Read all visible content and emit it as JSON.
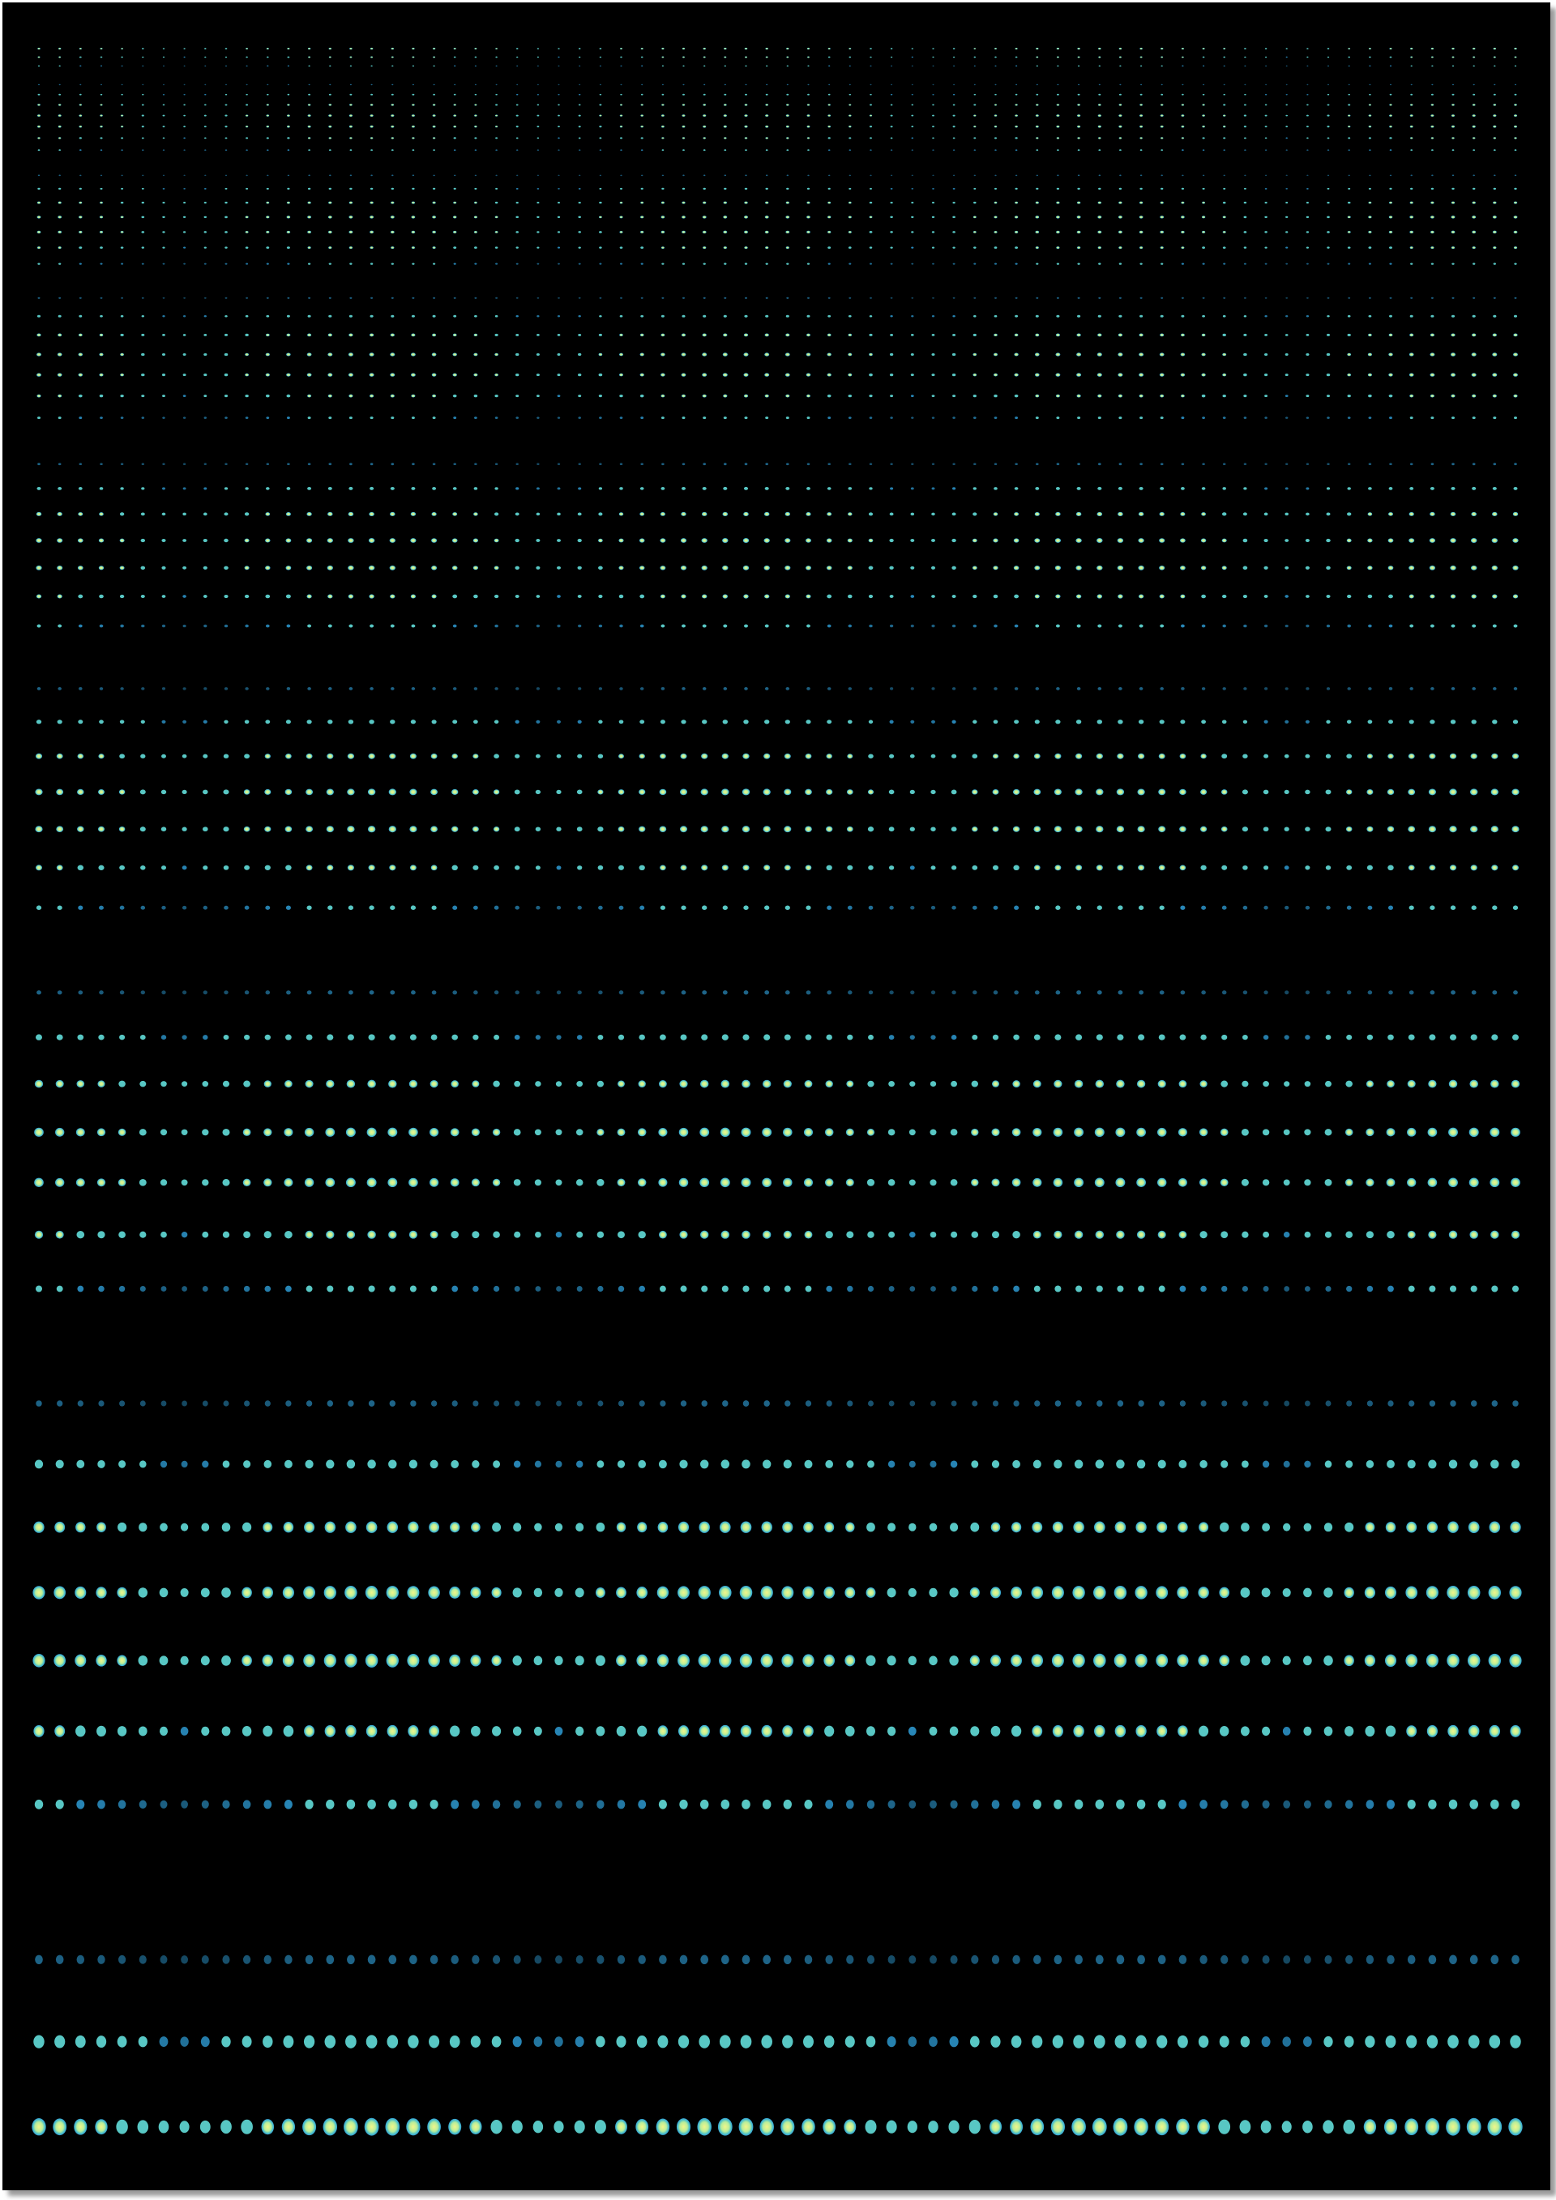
{
  "colors": {
    "page_background": "#ffffff",
    "panel_background": "#000000",
    "panel_shadow": "#9a9a9a",
    "dot_core": "#f2f58a",
    "dot_mid": "#8fe0b8",
    "dot_edge": "#2f9fd8"
  }
}
